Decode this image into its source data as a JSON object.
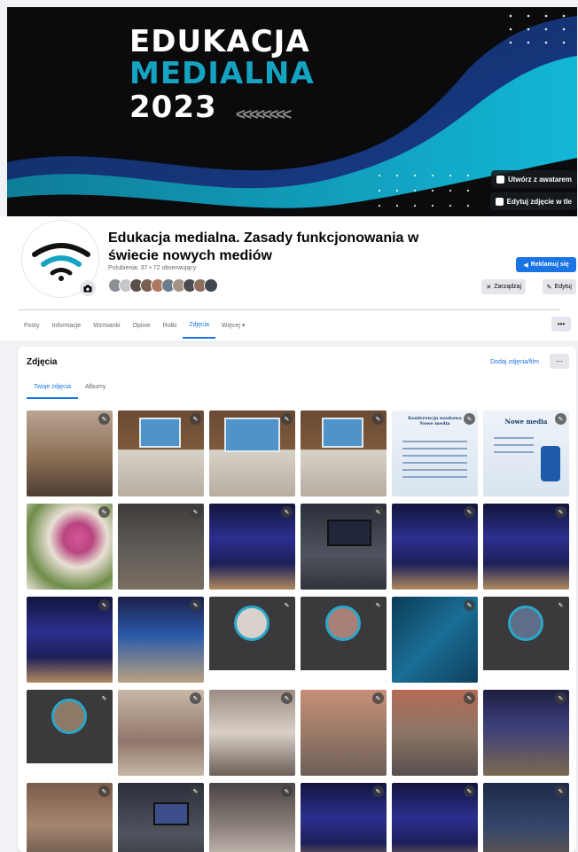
{
  "cover": {
    "line1": "EDUKACJA",
    "line2": "MEDIALNA",
    "line3": "2023",
    "chevrons": "<<<<<<<<",
    "btn_avatar": "Utwórz z awatarem",
    "btn_edit": "Edytuj zdjęcie w tle"
  },
  "profile": {
    "name": "Edukacja medialna. Zasady funkcjonowania w świecie nowych mediów",
    "stats": "Polubienia: 37 • 72 obserwujący",
    "promote": "Reklamuj się",
    "manage": "Zarządzaj",
    "edit": "Edytuj"
  },
  "tabs": [
    "Posty",
    "Informacje",
    "Wzmianki",
    "Opinie",
    "Rolki",
    "Zdjęcia",
    "Więcej ▾"
  ],
  "active_tab": "Zdjęcia",
  "photos": {
    "title": "Zdjęcia",
    "add_label": "Dodaj zdjęcia/film",
    "more": "···",
    "subtabs": [
      "Twoje zdjęcia",
      "Albumy"
    ],
    "doc1_title": "Konferencja naukowa Nowe media",
    "doc2_title": "Nowe media"
  },
  "icons": {
    "edit": "pencil-icon",
    "camera": "camera-icon",
    "more": "more-dots-icon"
  }
}
